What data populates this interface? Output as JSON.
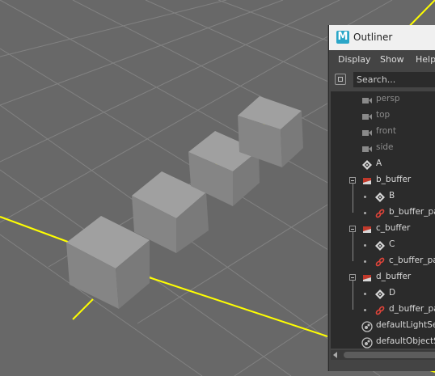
{
  "viewport": {
    "background": "#686868",
    "grid_color": "#8a8a8a",
    "axis_color": "#ffff00",
    "cube_color": "#8e8e8e"
  },
  "outliner": {
    "title": "Outliner",
    "logo_letter": "M",
    "menu": [
      "Display",
      "Show",
      "Help"
    ],
    "search_placeholder": "Search...",
    "items": [
      {
        "label": "persp",
        "icon": "camera-icon",
        "dim": true
      },
      {
        "label": "top",
        "icon": "camera-icon",
        "dim": true
      },
      {
        "label": "front",
        "icon": "camera-icon",
        "dim": true
      },
      {
        "label": "side",
        "icon": "camera-icon",
        "dim": true
      },
      {
        "label": "A",
        "icon": "transform-icon"
      },
      {
        "label": "b_buffer",
        "icon": "buffer-node-icon",
        "expanded": true
      },
      {
        "label": "B",
        "icon": "transform-icon",
        "child": true
      },
      {
        "label": "b_buffer_pa",
        "icon": "constraint-link-icon",
        "child": true
      },
      {
        "label": "c_buffer",
        "icon": "buffer-node-icon",
        "expanded": true
      },
      {
        "label": "C",
        "icon": "transform-icon",
        "child": true
      },
      {
        "label": "c_buffer_pa",
        "icon": "constraint-link-icon",
        "child": true
      },
      {
        "label": "d_buffer",
        "icon": "buffer-node-icon",
        "expanded": true
      },
      {
        "label": "D",
        "icon": "transform-icon",
        "child": true
      },
      {
        "label": "d_buffer_pa",
        "icon": "constraint-link-icon",
        "child": true
      },
      {
        "label": "defaultLightSe",
        "icon": "set-icon"
      },
      {
        "label": "defaultObjectS",
        "icon": "set-icon"
      }
    ]
  }
}
